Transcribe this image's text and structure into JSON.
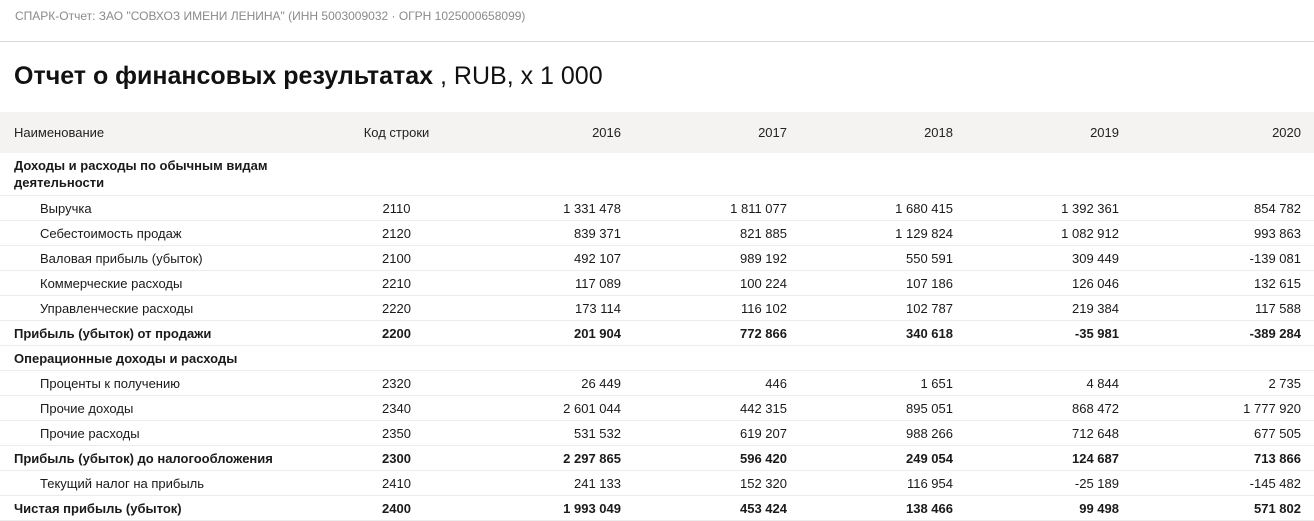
{
  "header": {
    "breadcrumb": "СПАРК-Отчет: ЗАО \"СОВХОЗ ИМЕНИ ЛЕНИНА\" (ИНН 5003009032 · ОГРН 1025000658099)"
  },
  "report": {
    "title": "Отчет о финансовых результатах",
    "unit": " , RUB, x 1 000"
  },
  "table": {
    "columns": {
      "name": "Наименование",
      "code": "Код строки",
      "y2016": "2016",
      "y2017": "2017",
      "y2018": "2018",
      "y2019": "2019",
      "y2020": "2020"
    },
    "rows": [
      {
        "name": "Доходы и расходы по обычным видам деятельности",
        "code": "",
        "values": [
          "",
          "",
          "",
          "",
          ""
        ]
      },
      {
        "name": "Выручка",
        "code": "2110",
        "values": [
          "1 331 478",
          "1 811 077",
          "1 680 415",
          "1 392 361",
          "854 782"
        ]
      },
      {
        "name": "Себестоимость продаж",
        "code": "2120",
        "values": [
          "839 371",
          "821 885",
          "1 129 824",
          "1 082 912",
          "993 863"
        ]
      },
      {
        "name": "Валовая прибыль (убыток)",
        "code": "2100",
        "values": [
          "492 107",
          "989 192",
          "550 591",
          "309 449",
          "-139 081"
        ]
      },
      {
        "name": "Коммерческие расходы",
        "code": "2210",
        "values": [
          "117 089",
          "100 224",
          "107 186",
          "126 046",
          "132 615"
        ]
      },
      {
        "name": "Управленческие расходы",
        "code": "2220",
        "values": [
          "173 114",
          "116 102",
          "102 787",
          "219 384",
          "117 588"
        ]
      },
      {
        "name": "Прибыль (убыток) от продажи",
        "code": "2200",
        "values": [
          "201 904",
          "772 866",
          "340 618",
          "-35 981",
          "-389 284"
        ]
      },
      {
        "name": "Операционные доходы и расходы",
        "code": "",
        "values": [
          "",
          "",
          "",
          "",
          ""
        ]
      },
      {
        "name": "Проценты к получению",
        "code": "2320",
        "values": [
          "26 449",
          "446",
          "1 651",
          "4 844",
          "2 735"
        ]
      },
      {
        "name": "Прочие доходы",
        "code": "2340",
        "values": [
          "2 601 044",
          "442 315",
          "895 051",
          "868 472",
          "1 777 920"
        ]
      },
      {
        "name": "Прочие расходы",
        "code": "2350",
        "values": [
          "531 532",
          "619 207",
          "988 266",
          "712 648",
          "677 505"
        ]
      },
      {
        "name": "Прибыль (убыток) до налогообложения",
        "code": "2300",
        "values": [
          "2 297 865",
          "596 420",
          "249 054",
          "124 687",
          "713 866"
        ]
      },
      {
        "name": "Текущий налог на прибыль",
        "code": "2410",
        "values": [
          "241 133",
          "152 320",
          "116 954",
          "-25 189",
          "-145 482"
        ]
      },
      {
        "name": "Чистая прибыль (убыток)",
        "code": "2400",
        "values": [
          "1 993 049",
          "453 424",
          "138 466",
          "99 498",
          "571 802"
        ]
      }
    ]
  }
}
